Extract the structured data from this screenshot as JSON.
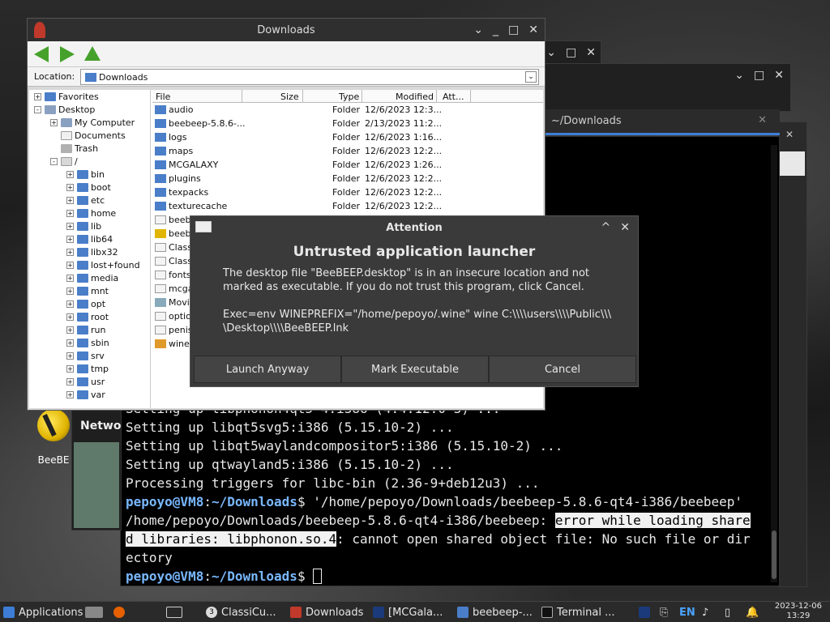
{
  "desktop": {
    "icon_label": "BeeBE"
  },
  "file_manager": {
    "title": "Downloads",
    "location_label": "Location:",
    "location_value": "Downloads",
    "columns": [
      "File",
      "Size",
      "Type",
      "Modified",
      "Att..."
    ],
    "tree": [
      {
        "label": "Favorites",
        "indent": 0,
        "expander": "+",
        "icon": "folder"
      },
      {
        "label": "Desktop",
        "indent": 0,
        "expander": "-",
        "icon": "desktop"
      },
      {
        "label": "My Computer",
        "indent": 1,
        "expander": "+",
        "icon": "computer"
      },
      {
        "label": "Documents",
        "indent": 1,
        "expander": "",
        "icon": "document"
      },
      {
        "label": "Trash",
        "indent": 1,
        "expander": "",
        "icon": "trash"
      },
      {
        "label": "/",
        "indent": 1,
        "expander": "-",
        "icon": "root"
      },
      {
        "label": "bin",
        "indent": 2,
        "expander": "+",
        "icon": "folder"
      },
      {
        "label": "boot",
        "indent": 2,
        "expander": "+",
        "icon": "folder"
      },
      {
        "label": "etc",
        "indent": 2,
        "expander": "+",
        "icon": "folder"
      },
      {
        "label": "home",
        "indent": 2,
        "expander": "+",
        "icon": "folder"
      },
      {
        "label": "lib",
        "indent": 2,
        "expander": "+",
        "icon": "folder"
      },
      {
        "label": "lib64",
        "indent": 2,
        "expander": "+",
        "icon": "folder"
      },
      {
        "label": "libx32",
        "indent": 2,
        "expander": "+",
        "icon": "folder"
      },
      {
        "label": "lost+found",
        "indent": 2,
        "expander": "+",
        "icon": "folder"
      },
      {
        "label": "media",
        "indent": 2,
        "expander": "+",
        "icon": "folder"
      },
      {
        "label": "mnt",
        "indent": 2,
        "expander": "+",
        "icon": "folder"
      },
      {
        "label": "opt",
        "indent": 2,
        "expander": "+",
        "icon": "folder"
      },
      {
        "label": "root",
        "indent": 2,
        "expander": "+",
        "icon": "folder"
      },
      {
        "label": "run",
        "indent": 2,
        "expander": "+",
        "icon": "folder"
      },
      {
        "label": "sbin",
        "indent": 2,
        "expander": "+",
        "icon": "folder"
      },
      {
        "label": "srv",
        "indent": 2,
        "expander": "+",
        "icon": "folder"
      },
      {
        "label": "tmp",
        "indent": 2,
        "expander": "+",
        "icon": "folder"
      },
      {
        "label": "usr",
        "indent": 2,
        "expander": "+",
        "icon": "folder"
      },
      {
        "label": "var",
        "indent": 2,
        "expander": "+",
        "icon": "folder"
      }
    ],
    "files": [
      {
        "name": "audio",
        "type": "Folder",
        "modified": "12/6/2023 12:3...",
        "icon": "folder"
      },
      {
        "name": "beebeep-5.8.6-...",
        "type": "Folder",
        "modified": "2/13/2023 11:2...",
        "icon": "folder"
      },
      {
        "name": "logs",
        "type": "Folder",
        "modified": "12/6/2023 1:16...",
        "icon": "folder"
      },
      {
        "name": "maps",
        "type": "Folder",
        "modified": "12/6/2023 12:2...",
        "icon": "folder"
      },
      {
        "name": "MCGALAXY",
        "type": "Folder",
        "modified": "12/6/2023 1:26...",
        "icon": "folder"
      },
      {
        "name": "plugins",
        "type": "Folder",
        "modified": "12/6/2023 12:2...",
        "icon": "folder"
      },
      {
        "name": "texpacks",
        "type": "Folder",
        "modified": "12/6/2023 12:2...",
        "icon": "folder"
      },
      {
        "name": "texturecache",
        "type": "Folder",
        "modified": "12/6/2023 12:2...",
        "icon": "folder"
      },
      {
        "name": "beebe",
        "type": "",
        "modified": "",
        "icon": "document"
      },
      {
        "name": "beebe",
        "type": "",
        "modified": "",
        "icon": "bee"
      },
      {
        "name": "Classi",
        "type": "",
        "modified": "",
        "icon": "document"
      },
      {
        "name": "Classi",
        "type": "",
        "modified": "",
        "icon": "document"
      },
      {
        "name": "fontsc",
        "type": "",
        "modified": "",
        "icon": "document"
      },
      {
        "name": "mcgal",
        "type": "",
        "modified": "",
        "icon": "document"
      },
      {
        "name": "Movie",
        "type": "",
        "modified": "",
        "icon": "movie"
      },
      {
        "name": "option",
        "type": "",
        "modified": "",
        "icon": "document"
      },
      {
        "name": "penis",
        "type": "",
        "modified": "",
        "icon": "document"
      },
      {
        "name": "wine-",
        "type": "",
        "modified": "",
        "icon": "archive"
      }
    ]
  },
  "terminal": {
    "tab_title": "~/Downloads",
    "lines": [
      {
        "parts": [
          {
            "t": "Setting up libphonon4qt5-4:i386 (4:4.12.0-3) ..."
          }
        ]
      },
      {
        "parts": [
          {
            "t": "Setting up libqt5svg5:i386 (5.15.10-2) ..."
          }
        ]
      },
      {
        "parts": [
          {
            "t": "Setting up libqt5waylandcompositor5:i386 (5.15.10-2) ..."
          }
        ]
      },
      {
        "parts": [
          {
            "t": "Setting up qtwayland5:i386 (5.15.10-2) ..."
          }
        ]
      },
      {
        "parts": [
          {
            "t": "Processing triggers for libc-bin (2.36-9+deb12u3) ..."
          }
        ]
      },
      {
        "parts": [
          {
            "t": "pepoyo@VM8",
            "c": "p-user"
          },
          {
            "t": ":"
          },
          {
            "t": "~/Downloads",
            "c": "p-path"
          },
          {
            "t": "$ '/home/pepoyo/Downloads/beebeep-5.8.6-qt4-i386/beebeep'"
          }
        ]
      },
      {
        "parts": [
          {
            "t": "/home/pepoyo/Downloads/beebeep-5.8.6-qt4-i386/beebeep: "
          },
          {
            "t": "error while loading share",
            "c": "hl"
          }
        ]
      },
      {
        "parts": [
          {
            "t": "d libraries: libphonon.so.4",
            "c": "hl"
          },
          {
            "t": ": cannot open shared object file: No such file or dir"
          }
        ]
      },
      {
        "parts": [
          {
            "t": "ectory"
          }
        ]
      },
      {
        "parts": [
          {
            "t": "pepoyo@VM8",
            "c": "p-user"
          },
          {
            "t": ":"
          },
          {
            "t": "~/Downloads",
            "c": "p-path"
          },
          {
            "t": "$ "
          },
          {
            "t": "",
            "c": "cursor"
          }
        ]
      }
    ]
  },
  "dialog": {
    "title": "Attention",
    "heading": "Untrusted application launcher",
    "message": "The desktop file \"BeeBEEP.desktop\" is in an insecure location and not\nmarked as executable. If you do not trust this program, click Cancel.\n\nExec=env WINEPREFIX=\"/home/pepoyo/.wine\" wine C:\\\\\\\\users\\\\\\\\Public\\\\\\\n\\Desktop\\\\\\\\BeeBEEP.lnk",
    "buttons": {
      "launch": "Launch Anyway",
      "mark": "Mark Executable",
      "cancel": "Cancel"
    }
  },
  "side_panel": {
    "label": "Netwo"
  },
  "taskbar": {
    "applications": "Applications",
    "tasks": [
      {
        "label": "ClassiCu...",
        "badge": "3"
      },
      {
        "label": "Downloads"
      },
      {
        "label": "[MCGala..."
      },
      {
        "label": "beebeep-..."
      },
      {
        "label": "Terminal ..."
      }
    ],
    "lang": "EN",
    "date": "2023-12-06",
    "time": "13:29"
  },
  "colors": {
    "prompt": "#79b8ff",
    "folder": "#4a7ec9",
    "nav_arrow": "#46a12c"
  }
}
